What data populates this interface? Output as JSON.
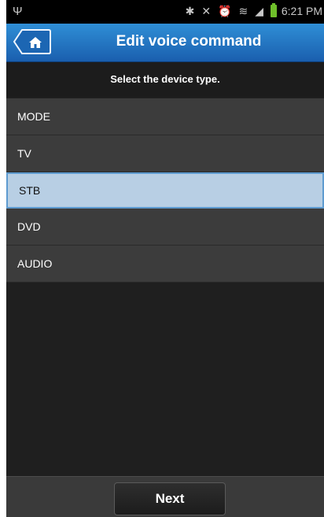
{
  "status_bar": {
    "usb_icon": "usb-icon",
    "icons": [
      "bluetooth-icon",
      "mute-icon",
      "alarm-icon",
      "wifi-icon",
      "signal-icon",
      "battery-icon"
    ],
    "time": "6:21 PM"
  },
  "app_bar": {
    "title": "Edit voice command",
    "home_icon": "home-icon"
  },
  "prompt": "Select the device type.",
  "device_types": [
    {
      "label": "MODE",
      "selected": false
    },
    {
      "label": "TV",
      "selected": false
    },
    {
      "label": "STB",
      "selected": true
    },
    {
      "label": "DVD",
      "selected": false
    },
    {
      "label": "AUDIO",
      "selected": false
    }
  ],
  "bottom_bar": {
    "next_label": "Next"
  },
  "colors": {
    "accent": "#1a5fae",
    "selected_bg": "#b8cfe4",
    "list_bg": "#3c3c3c"
  }
}
